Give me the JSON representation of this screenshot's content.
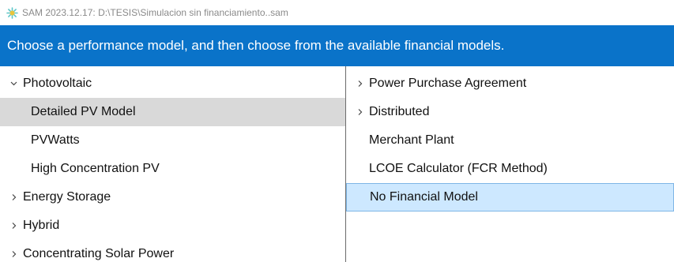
{
  "window": {
    "title": "SAM 2023.12.17: D:\\TESIS\\Simulacion sin financiamiento..sam"
  },
  "banner": {
    "text": "Choose a performance model, and then choose from the available financial models."
  },
  "performance_models": [
    {
      "label": "Photovoltaic",
      "level": 0,
      "expander": "chevron-down",
      "selected": false
    },
    {
      "label": "Detailed PV Model",
      "level": 1,
      "expander": null,
      "selected": true
    },
    {
      "label": "PVWatts",
      "level": 1,
      "expander": null,
      "selected": false
    },
    {
      "label": "High Concentration PV",
      "level": 1,
      "expander": null,
      "selected": false
    },
    {
      "label": "Energy Storage",
      "level": 0,
      "expander": "chevron-right",
      "selected": false
    },
    {
      "label": "Hybrid",
      "level": 0,
      "expander": "chevron-right",
      "selected": false
    },
    {
      "label": "Concentrating Solar Power",
      "level": 0,
      "expander": "chevron-right",
      "selected": false
    }
  ],
  "financial_models": [
    {
      "label": "Power Purchase Agreement",
      "expander": "chevron-right",
      "selected": false
    },
    {
      "label": "Distributed",
      "expander": "chevron-right",
      "selected": false
    },
    {
      "label": "Merchant Plant",
      "expander": null,
      "selected": false
    },
    {
      "label": "LCOE Calculator (FCR Method)",
      "expander": null,
      "selected": false
    },
    {
      "label": "No Financial Model",
      "expander": null,
      "selected": true
    }
  ],
  "colors": {
    "banner": "#0a73c9",
    "selected_gray": "#d9d9d9",
    "selected_blue": "#cde8ff"
  },
  "icons": {
    "app": "sam-sun-icon",
    "expanded": "chevron-down-icon",
    "collapsed": "chevron-right-icon"
  }
}
